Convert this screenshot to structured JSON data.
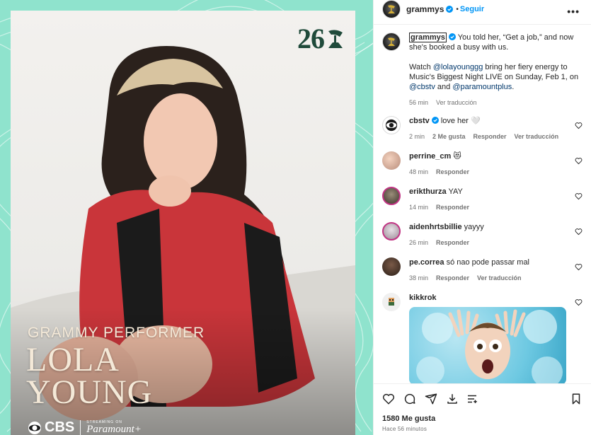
{
  "post": {
    "author": "grammys",
    "follow_label": "Seguir",
    "separator": "•",
    "more_label": "•••",
    "likes": "1580 Me gusta",
    "posted_ago": "Hace 56 minutos"
  },
  "poster": {
    "edition_number": "26",
    "performer_label": "GRAMMY PERFORMER",
    "name_line_1": "LOLA",
    "name_line_2": "YOUNG",
    "network": "CBS",
    "streaming_small": "STREAMING ON",
    "streaming_brand": "Paramount+"
  },
  "caption": {
    "user": "grammys",
    "text_1": " You told her, “Get a job,” and now she's booked a busy with us.",
    "text_2_prefix": "Watch ",
    "mention_1": "@lolayounggg",
    "text_2_mid": " bring her fiery energy to Music's Biggest Night LIVE on Sunday, Feb 1, on ",
    "mention_2": "@cbstv",
    "text_2_and": " and ",
    "mention_3": "@paramountplus",
    "text_2_end": ".",
    "time": "56 min",
    "translate": "Ver traducción"
  },
  "comments": [
    {
      "user": "cbstv",
      "text": "love her 🤍",
      "time": "2 min",
      "likes": "2 Me gusta",
      "reply": "Responder",
      "translate": "Ver traducción"
    },
    {
      "user": "perrine_cm",
      "text": "😻",
      "time": "48 min",
      "reply": "Responder"
    },
    {
      "user": "erikthurza",
      "text": "YAY",
      "time": "14 min",
      "reply": "Responder"
    },
    {
      "user": "aidenhrtsbillie",
      "text": "yayyy",
      "time": "26 min",
      "reply": "Responder"
    },
    {
      "user": "pe.correa",
      "text": "só nao pode passar mal",
      "time": "38 min",
      "reply": "Responder",
      "translate": "Ver traducción"
    },
    {
      "user": "kikkrok",
      "text": ""
    }
  ],
  "colors": {
    "link": "#00376b",
    "follow": "#0095f6",
    "media_bg": "#8fe3cd",
    "poster_text": "#f4e9d8"
  },
  "icons": [
    "verified-badge-icon",
    "heart-icon",
    "comment-icon",
    "share-icon",
    "save-icon",
    "bookmark-icon",
    "more-icon"
  ]
}
